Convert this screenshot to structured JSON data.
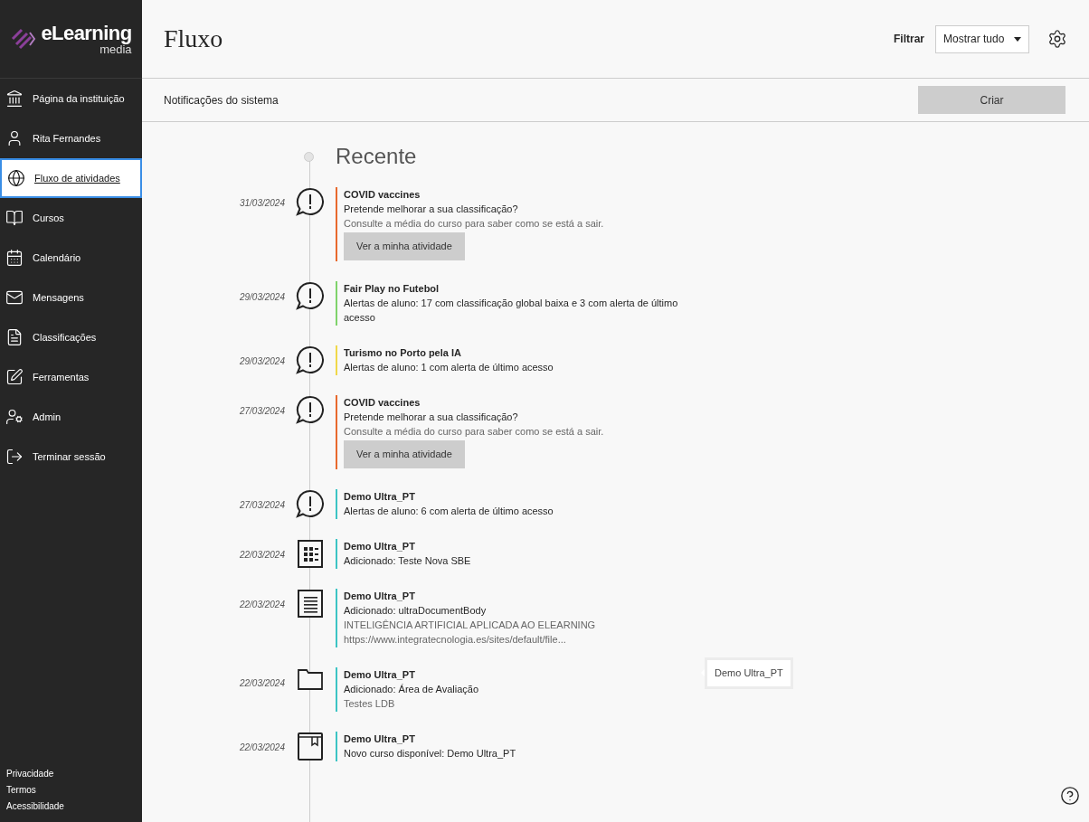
{
  "logo": {
    "name": "eLearning",
    "sub": "media"
  },
  "nav": [
    {
      "label": "Página da instituição",
      "selected": false
    },
    {
      "label": "Rita Fernandes",
      "selected": false
    },
    {
      "label": "Fluxo de atividades",
      "selected": true
    },
    {
      "label": "Cursos",
      "selected": false
    },
    {
      "label": "Calendário",
      "selected": false
    },
    {
      "label": "Mensagens",
      "selected": false
    },
    {
      "label": "Classificações",
      "selected": false
    },
    {
      "label": "Ferramentas",
      "selected": false
    },
    {
      "label": "Admin",
      "selected": false
    },
    {
      "label": "Terminar sessão",
      "selected": false
    }
  ],
  "footer_links": [
    "Privacidade",
    "Termos",
    "Acessibilidade"
  ],
  "header": {
    "title": "Fluxo",
    "filter_label": "Filtrar",
    "filter_value": "Mostrar tudo"
  },
  "subbar": {
    "label": "Notificações do sistema",
    "button": "Criar"
  },
  "section": "Recente",
  "feed": [
    {
      "date": "31/03/2024",
      "kind": "alert",
      "color": "#e8692d",
      "title": "COVID vaccines",
      "lines": [
        {
          "text": "Pretende melhorar a sua classificação?",
          "muted": false
        },
        {
          "text": "Consulte a média do curso para saber como se está a sair.",
          "muted": true
        }
      ],
      "button": "Ver a minha atividade"
    },
    {
      "date": "29/03/2024",
      "kind": "alert",
      "color": "#7fd36b",
      "title": "Fair Play no Futebol",
      "lines": [
        {
          "text": "Alertas de aluno: 17 com classificação global baixa e 3 com alerta de último acesso",
          "muted": false
        }
      ]
    },
    {
      "date": "29/03/2024",
      "kind": "alert",
      "color": "#f0d84a",
      "title": "Turismo no Porto pela IA",
      "lines": [
        {
          "text": "Alertas de aluno: 1 com alerta de último acesso",
          "muted": false
        }
      ]
    },
    {
      "date": "27/03/2024",
      "kind": "alert",
      "color": "#e8692d",
      "title": "COVID vaccines",
      "lines": [
        {
          "text": "Pretende melhorar a sua classificação?",
          "muted": false
        },
        {
          "text": "Consulte a média do curso para saber como se está a sair.",
          "muted": true
        }
      ],
      "button": "Ver a minha atividade"
    },
    {
      "date": "27/03/2024",
      "kind": "alert",
      "color": "#3cc4c4",
      "title": "Demo Ultra_PT",
      "lines": [
        {
          "text": "Alertas de aluno: 6 com alerta de último acesso",
          "muted": false
        }
      ]
    },
    {
      "date": "22/03/2024",
      "kind": "test",
      "color": "#3cc4c4",
      "title": "Demo Ultra_PT",
      "lines": [
        {
          "text": "Adicionado: Teste Nova SBE",
          "muted": false
        }
      ]
    },
    {
      "date": "22/03/2024",
      "kind": "document",
      "color": "#3cc4c4",
      "title": "Demo Ultra_PT",
      "lines": [
        {
          "text": "Adicionado: ultraDocumentBody",
          "muted": false
        },
        {
          "text": "INTELIGÊNCIA ARTIFICIAL APLICADA AO ELEARNING",
          "muted": true
        },
        {
          "text": "https://www.integratecnologia.es/sites/default/file...",
          "muted": true
        }
      ]
    },
    {
      "date": "22/03/2024",
      "kind": "folder",
      "color": "#3cc4c4",
      "title": "Demo Ultra_PT",
      "lines": [
        {
          "text": "Adicionado: Área de Avaliação",
          "muted": false
        },
        {
          "text": "Testes LDB",
          "muted": true
        }
      ],
      "tooltip": "Demo Ultra_PT"
    },
    {
      "date": "22/03/2024",
      "kind": "course",
      "color": "#3cc4c4",
      "title": "Demo Ultra_PT",
      "lines": [
        {
          "text": "Novo curso disponível: Demo Ultra_PT",
          "muted": false
        }
      ]
    }
  ]
}
